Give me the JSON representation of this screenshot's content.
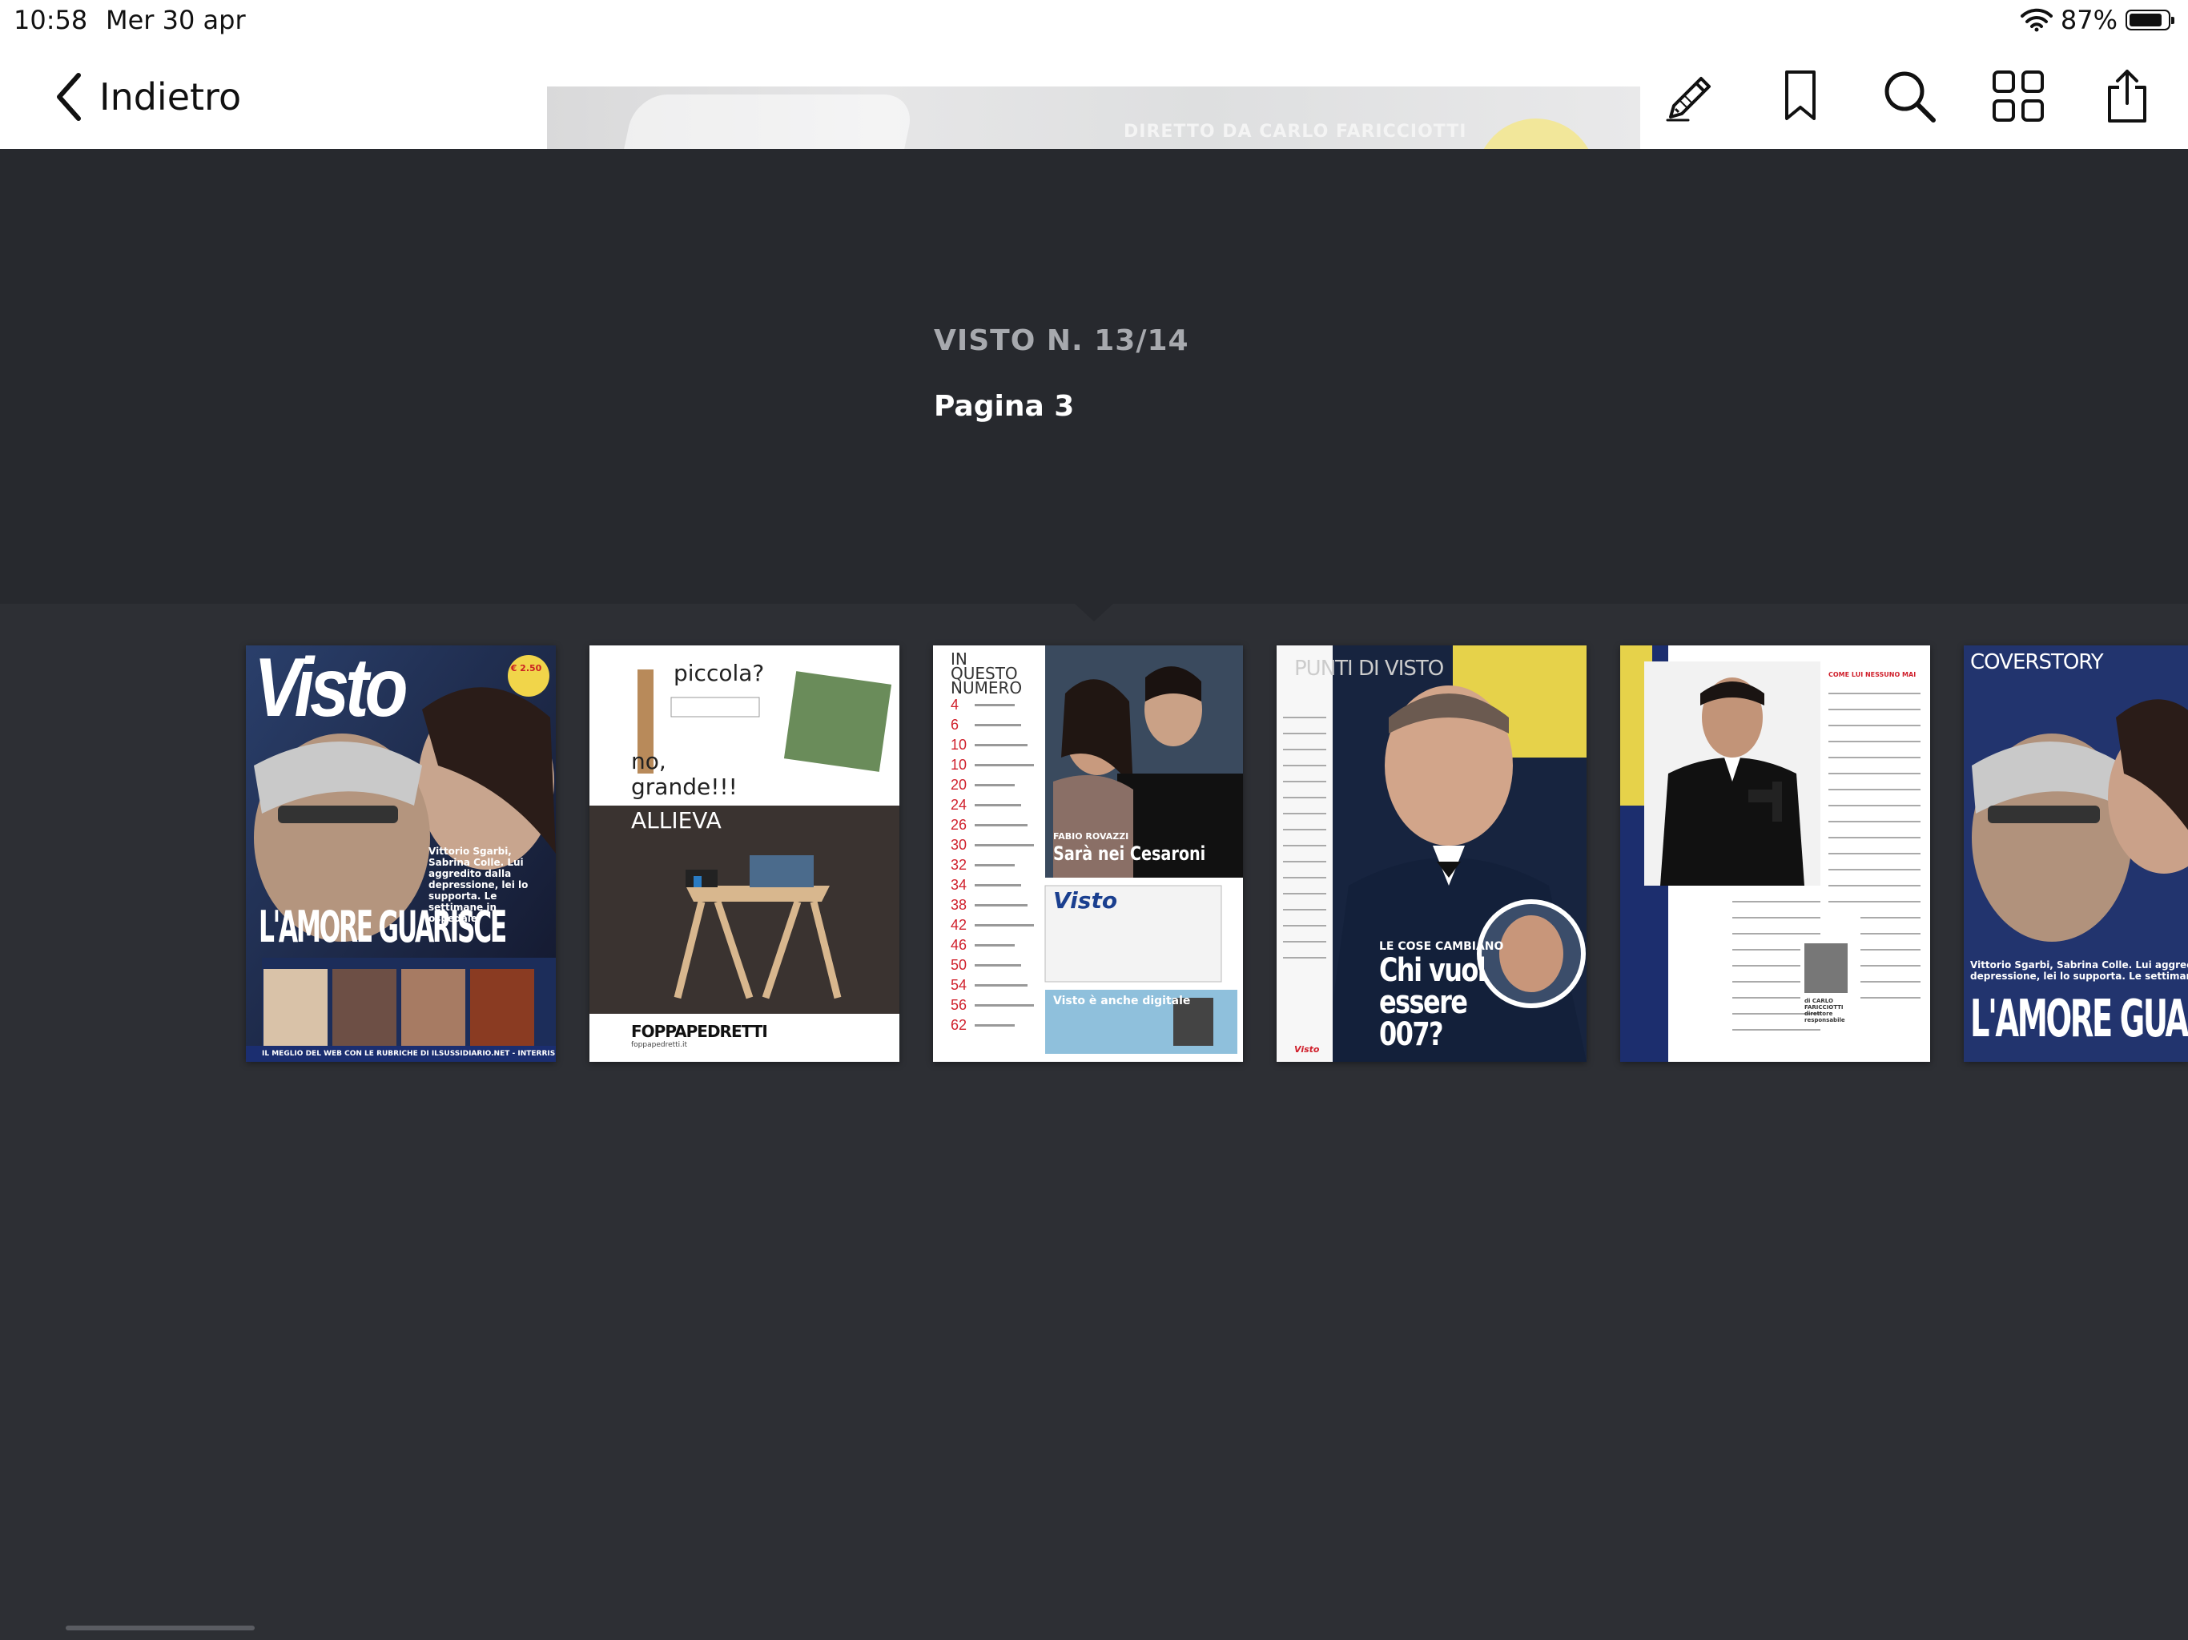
{
  "status": {
    "time": "10:58",
    "date": "Mer 30 apr",
    "battery_pct": "87%",
    "battery_level": 0.87
  },
  "nav": {
    "back_label": "Indietro",
    "cover_strip_text": "DIRETTO DA CARLO FARICCIOTTI",
    "tools": [
      {
        "icon": "pencil-icon"
      },
      {
        "icon": "bookmark-icon"
      },
      {
        "icon": "search-icon"
      },
      {
        "icon": "grid-icon"
      },
      {
        "icon": "share-icon"
      }
    ]
  },
  "info": {
    "issue": "VISTO N. 13/14",
    "page": "Pagina 3"
  },
  "pages": [
    {
      "id": "cover",
      "logo": "Visto",
      "headline": "L'AMORE GUARISCE",
      "teaser": "Vittorio Sgarbi, Sabrina Colle. Lui aggredito dalla depressione, lei lo supporta. Le settimane in ospedale",
      "footer": "IL MEGLIO DEL WEB CON LE RUBRICHE DI ILSUSSIDIARIO.NET - INTERRIS.IT",
      "price": "€ 2.50"
    },
    {
      "id": "ad",
      "line1": "piccola?",
      "line2": "no,",
      "line3": "grande!!!",
      "line4": "ALLIEVA",
      "brand": "FOPPAPEDRETTI",
      "site": "foppapedretti.it"
    },
    {
      "id": "toc",
      "title": "IN QUESTO NUMERO",
      "names": "FABIO ROVAZZI",
      "headline": "Sarà nei Cesaroni",
      "digital": "Visto è anche digitale",
      "logo": "Visto",
      "numbers": [
        "4",
        "6",
        "10",
        "10",
        "20",
        "24",
        "26",
        "30",
        "32",
        "34",
        "38",
        "42",
        "46",
        "50",
        "54",
        "56",
        "62"
      ]
    },
    {
      "id": "story1",
      "section": "PUNTI DI VISTO",
      "kicker": "LE COSE CAMBIANO",
      "headline": "Chi vuol essere 007?",
      "logo": "Visto"
    },
    {
      "id": "story2",
      "heading": "COME LUI NESSUNO MAI",
      "caption": "Amazon decide il futuro di 007: dopo quattro anni dall'addio di Daniel Craig, Jeff Bezos lancia su Instagram un sondaggio per scegliere il nuovo James Bond",
      "byline": "di CARLO FARICCIOTTI direttore responsabile"
    },
    {
      "id": "coverstory",
      "section": "COVERSTORY",
      "teaser": "Vittorio Sgarbi, Sabrina Colle. Lui aggredito dalla depressione, lei lo supporta. Le settimane in ospedale",
      "headline": "L'AMORE GUARISCE"
    }
  ],
  "colors": {
    "background": "#27292e",
    "strip": "#2d2f34",
    "accent_red": "#d0202c",
    "visto_blue": "#1a3f8f"
  }
}
